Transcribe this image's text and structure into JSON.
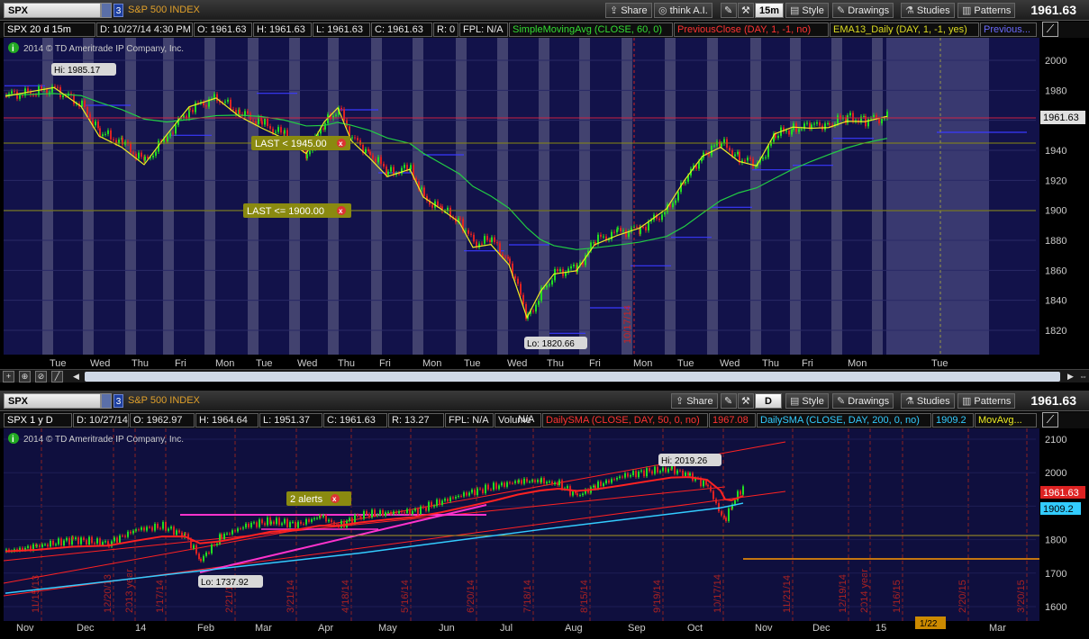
{
  "top": {
    "symbol": "SPX",
    "link": "3",
    "description": "S&P 500 INDEX",
    "buttons": {
      "share": "Share",
      "think": "think A.I.",
      "period": "15m",
      "style": "Style",
      "drawings": "Drawings",
      "studies": "Studies",
      "patterns": "Patterns"
    },
    "last_price": "1961.63",
    "info": {
      "chart": "SPX 20 d 15m",
      "date": "D: 10/27/14 4:30 PM",
      "open": "O: 1961.63",
      "high": "H: 1961.63",
      "low": "L: 1961.63",
      "close": "C: 1961.63",
      "range": "R: 0",
      "fpl": "FPL: N/A",
      "study1": "SimpleMovingAvg (CLOSE, 60, 0)",
      "study2": "PreviousClose (DAY, 1, -1, no)",
      "study3": "EMA13_Daily (DAY, 1, -1, yes)",
      "study4": "Previous..."
    },
    "copyright": "2014 © TD Ameritrade IP Company, Inc.",
    "hi_label": "Hi: 1985.17",
    "lo_label": "Lo: 1820.66",
    "alert1": "LAST < 1945.00",
    "alert2": "LAST <= 1900.00",
    "date_marker": "10/17/14",
    "price_tag": "1961.63",
    "yticks": [
      "2000",
      "1980",
      "1960",
      "1940",
      "1920",
      "1900",
      "1880",
      "1860",
      "1840",
      "1820"
    ],
    "xlabels": [
      "Tue",
      "Wed",
      "Thu",
      "Fri",
      "Mon",
      "Tue",
      "Wed",
      "Thu",
      "Fri",
      "Mon",
      "Tue",
      "Wed",
      "Thu",
      "Fri",
      "Mon",
      "Tue",
      "Wed",
      "Thu",
      "Fri",
      "Mon",
      "Tue"
    ]
  },
  "bottom": {
    "symbol": "SPX",
    "link": "3",
    "description": "S&P 500 INDEX",
    "buttons": {
      "share": "Share",
      "period": "D",
      "style": "Style",
      "drawings": "Drawings",
      "studies": "Studies",
      "patterns": "Patterns"
    },
    "last_price": "1961.63",
    "info": {
      "chart": "SPX 1 y D",
      "date": "D: 10/27/14",
      "open": "O: 1962.97",
      "high": "H: 1964.64",
      "low": "L: 1951.37",
      "close": "C: 1961.63",
      "range": "R: 13.27",
      "fpl": "FPL: N/A",
      "volume": "Volume",
      "volume_val": "N/A",
      "study1": "DailySMA (CLOSE, DAY, 50, 0, no)",
      "study1_val": "1967.08",
      "study2": "DailySMA (CLOSE, DAY, 200, 0, no)",
      "study2_val": "1909.2",
      "study3": "MovAvg..."
    },
    "copyright": "2014 © TD Ameritrade IP Company, Inc.",
    "hi_label": "Hi: 2019.26",
    "lo_label": "Lo: 1737.92",
    "alert": "2 alerts",
    "price_tag1": "1961.63",
    "price_tag2": "1909.2",
    "yticks": [
      "2100",
      "2000",
      "1900",
      "1800",
      "1700",
      "1600"
    ],
    "xlabels": [
      "Nov",
      "Dec",
      "14",
      "Feb",
      "Mar",
      "Apr",
      "May",
      "Jun",
      "Jul",
      "Aug",
      "Sep",
      "Oct",
      "Nov",
      "Dec",
      "15",
      "Mar"
    ],
    "xbox": "1/22",
    "vlabels": [
      "11/15/13",
      "12/20/13",
      "2013 year",
      "1/17/14",
      "2/21/14",
      "3/21/14",
      "4/18/14",
      "5/16/14",
      "6/20/14",
      "7/18/14",
      "8/15/14",
      "9/19/14",
      "10/17/14",
      "11/21/14",
      "12/19/14",
      "2014 year",
      "1/16/15",
      "2/20/15",
      "3/20/15"
    ]
  },
  "colors": {
    "bg_top": "#12124a",
    "bg_bottom": "#0f0f3e",
    "up": "#22dd22",
    "down": "#dd2222",
    "sma": "#22cc44",
    "ema": "#eeee22",
    "prev": "#4040ff",
    "alert": "#8a8a10",
    "pink": "#ff33cc",
    "cyan": "#33ccff"
  }
}
